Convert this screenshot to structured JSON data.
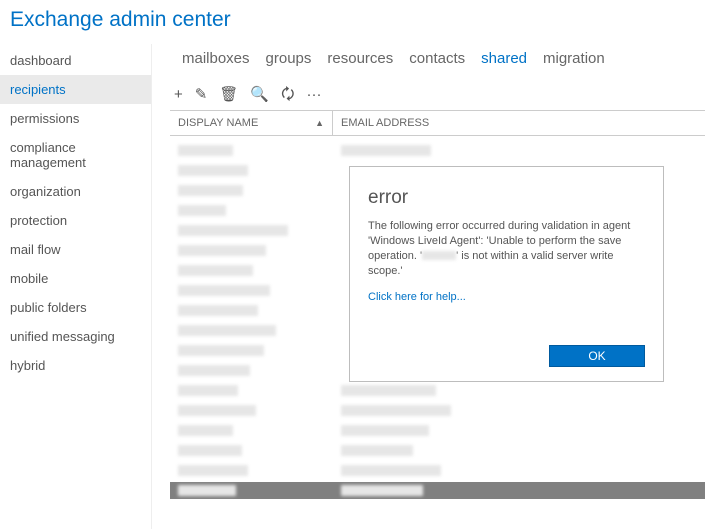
{
  "header": {
    "title": "Exchange admin center"
  },
  "sidebar": {
    "items": [
      "dashboard",
      "recipients",
      "permissions",
      "compliance management",
      "organization",
      "protection",
      "mail flow",
      "mobile",
      "public folders",
      "unified messaging",
      "hybrid"
    ],
    "active_index": 1
  },
  "tabs": {
    "items": [
      "mailboxes",
      "groups",
      "resources",
      "contacts",
      "shared",
      "migration"
    ],
    "active_index": 4
  },
  "toolbar": {
    "icons": [
      "plus-icon",
      "edit-icon",
      "delete-icon",
      "search-icon",
      "refresh-icon",
      "more-icon"
    ]
  },
  "columns": {
    "name": "DISPLAY NAME",
    "email": "EMAIL ADDRESS",
    "sort_asc": "▲"
  },
  "rows": [
    {
      "nw": 55,
      "ew": 90
    },
    {
      "nw": 70,
      "ew": 0
    },
    {
      "nw": 65,
      "ew": 0
    },
    {
      "nw": 48,
      "ew": 0
    },
    {
      "nw": 110,
      "ew": 0
    },
    {
      "nw": 88,
      "ew": 0
    },
    {
      "nw": 75,
      "ew": 0
    },
    {
      "nw": 92,
      "ew": 0
    },
    {
      "nw": 80,
      "ew": 0
    },
    {
      "nw": 98,
      "ew": 0
    },
    {
      "nw": 86,
      "ew": 0
    },
    {
      "nw": 72,
      "ew": 0
    },
    {
      "nw": 60,
      "ew": 95
    },
    {
      "nw": 78,
      "ew": 110
    },
    {
      "nw": 55,
      "ew": 88
    },
    {
      "nw": 64,
      "ew": 72
    },
    {
      "nw": 70,
      "ew": 100
    },
    {
      "nw": 58,
      "ew": 82
    }
  ],
  "selected_row_index": 17,
  "dialog": {
    "title": "error",
    "message_pre": "The following error occurred during validation in agent 'Windows LiveId Agent': 'Unable to perform the save operation. '",
    "message_post": "' is not within a valid server write scope.'",
    "help_link": "Click here for help...",
    "ok_label": "OK"
  }
}
